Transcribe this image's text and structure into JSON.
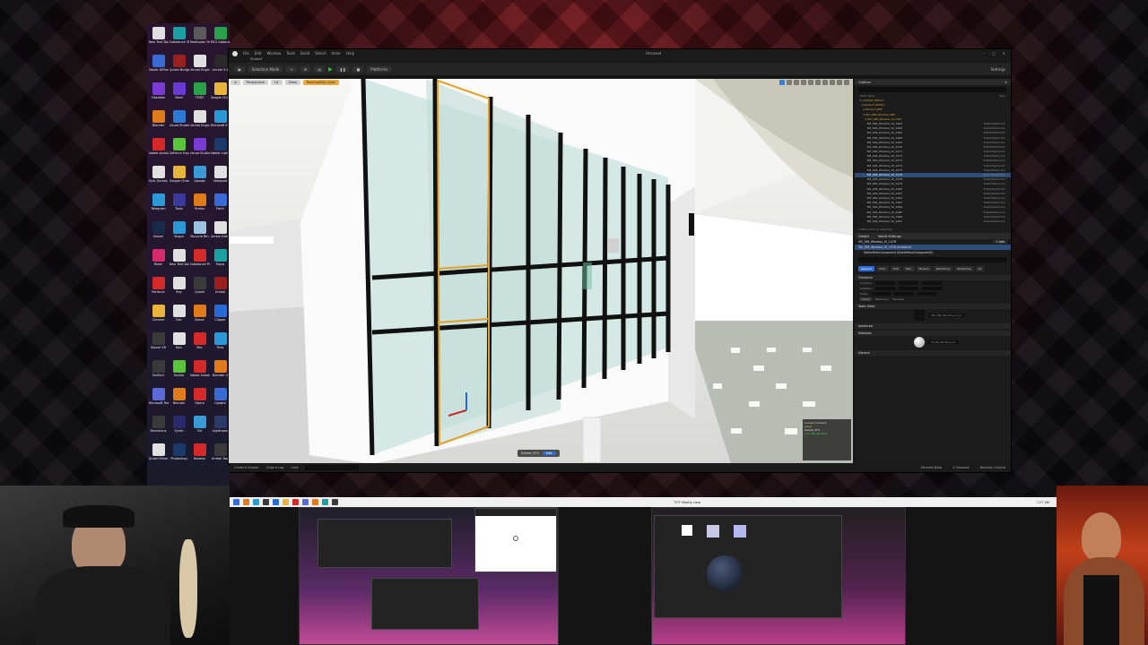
{
  "desktop": {
    "icons": [
      {
        "label": "New Text Document",
        "color": "#e0e0e0"
      },
      {
        "label": "Substance 3D Designer",
        "color": "#1aa1a1"
      },
      {
        "label": "Reallusion Hub",
        "color": "#5a5a5a"
      },
      {
        "label": "MCS Addons",
        "color": "#2aa04a"
      },
      {
        "label": "Stable Diffusion",
        "color": "#3a6ad6"
      },
      {
        "label": "Quixel Bridge",
        "color": "#9a1f1f"
      },
      {
        "label": "Unreal Engine",
        "color": "#e0e0e0"
      },
      {
        "label": "Unreal 5.4",
        "color": "#2a2a2a"
      },
      {
        "label": "Obsidian",
        "color": "#7a3ad6"
      },
      {
        "label": "Viber",
        "color": "#6a3ad6"
      },
      {
        "label": "TDR3",
        "color": "#2aa04a"
      },
      {
        "label": "Google Chrome",
        "color": "#e8b43a"
      },
      {
        "label": "Blender",
        "color": "#e07a1a"
      },
      {
        "label": "Visual Studio Code",
        "color": "#2a7ad6"
      },
      {
        "label": "Unreal Engine 5",
        "color": "#e0e0e0"
      },
      {
        "label": "Microsoft Edge",
        "color": "#2a9ad6"
      },
      {
        "label": "Adobe Acrobat",
        "color": "#d62a2a"
      },
      {
        "label": "GeForce Experience",
        "color": "#5ac43a"
      },
      {
        "label": "Visual Studio",
        "color": "#7a3ad6"
      },
      {
        "label": "Adobe Lightroom",
        "color": "#1a3a6a"
      },
      {
        "label": "Epic Games",
        "color": "#e0e0e0"
      },
      {
        "label": "Google Chrome",
        "color": "#e8b43a"
      },
      {
        "label": "Qooqle",
        "color": "#3a9ad6"
      },
      {
        "label": "Notepad",
        "color": "#e0e0e0"
      },
      {
        "label": "Telegram",
        "color": "#2a9ad6"
      },
      {
        "label": "Tools",
        "color": "#3a3a9a"
      },
      {
        "label": "Firefox",
        "color": "#e07a1a"
      },
      {
        "label": "Paint",
        "color": "#3a6ad6"
      },
      {
        "label": "Steam",
        "color": "#1a2a4a"
      },
      {
        "label": "Skype",
        "color": "#2a9ad6"
      },
      {
        "label": "Recycle Bin",
        "color": "#9ac4e0"
      },
      {
        "label": "Unreal Editor",
        "color": "#e0e0e0"
      },
      {
        "label": "Rider",
        "color": "#d62a6a"
      },
      {
        "label": "New Text Document",
        "color": "#e0e0e0"
      },
      {
        "label": "Substance Painter",
        "color": "#d62a2a"
      },
      {
        "label": "Maya",
        "color": "#1aa1a1"
      },
      {
        "label": "Perforce",
        "color": "#d62a2a"
      },
      {
        "label": "Ray",
        "color": "#e0e0e0"
      },
      {
        "label": "Quixel",
        "color": "#3a3a3a"
      },
      {
        "label": "Unreal",
        "color": "#9a1f1f"
      },
      {
        "label": "Chrome",
        "color": "#e8b43a"
      },
      {
        "label": "Doc",
        "color": "#e0e0e0"
      },
      {
        "label": "Brave",
        "color": "#e07a1a"
      },
      {
        "label": "Clipper",
        "color": "#2a6ad6"
      },
      {
        "label": "Steam VR",
        "color": "#3a3a3a"
      },
      {
        "label": "Epic",
        "color": "#e0e0e0"
      },
      {
        "label": "Rec",
        "color": "#d62a2a"
      },
      {
        "label": "Files",
        "color": "#2a9ad6"
      },
      {
        "label": "DaVinci",
        "color": "#3a3a3a"
      },
      {
        "label": "Nvidia",
        "color": "#5ac43a"
      },
      {
        "label": "Adobe Substance",
        "color": "#d62a2a"
      },
      {
        "label": "Blender 4",
        "color": "#e07a1a"
      },
      {
        "label": "Microsoft Teams",
        "color": "#5a6ad6"
      },
      {
        "label": "Blender",
        "color": "#e07a1a"
      },
      {
        "label": "Opera",
        "color": "#d62a2a"
      },
      {
        "label": "Update",
        "color": "#3a6ad6"
      },
      {
        "label": "Marvelous",
        "color": "#3a3a3a"
      },
      {
        "label": "Synth",
        "color": "#2a2a6a"
      },
      {
        "label": "Git",
        "color": "#3a9ad6"
      },
      {
        "label": "Lightroom",
        "color": "#2a3a6a"
      },
      {
        "label": "Quixel Mixer",
        "color": "#e0e0e0"
      },
      {
        "label": "Photoshop",
        "color": "#1a3a6a"
      },
      {
        "label": "Radeon",
        "color": "#d62a2a"
      },
      {
        "label": "Unreal Tool",
        "color": "#3a3a3a"
      },
      {
        "label": "Zoom",
        "color": "#2a6ad6"
      },
      {
        "label": "Sublime",
        "color": "#e07a1a"
      },
      {
        "label": "Discord",
        "color": "#5a6ad6"
      },
      {
        "label": "Affinity",
        "color": "#d62a2a"
      }
    ]
  },
  "ue": {
    "title": "Unsaved",
    "menu": [
      "File",
      "Edit",
      "Window",
      "Tools",
      "Build",
      "Select",
      "Actor",
      "Help"
    ],
    "level_name": "Studio3",
    "toolbar": {
      "mode": "Selection Mode",
      "platforms": "Platforms",
      "settings": "Settings"
    },
    "viewport": {
      "perspective": "Perspective",
      "lit": "Lit",
      "show": "Show",
      "highlight": "Reachability Lines",
      "status_label": "Delete_SFX",
      "status_btn": "Edit",
      "stats": [
        {
          "text": "Current Context",
          "cls": ""
        },
        {
          "text": "Level",
          "cls": "y"
        },
        {
          "text": "Delete_SFX",
          "cls": ""
        },
        {
          "text": "[ 1 ] SM_Window",
          "cls": "g"
        }
      ]
    },
    "outliner": {
      "tab": "Outliner",
      "col_label": "Item Label",
      "col_type": "Type",
      "rows": [
        {
          "name": "▾ Untitled (Editor)",
          "type": "",
          "folder": true,
          "sel": false
        },
        {
          "name": "  ▾ Studio3 (Editor)",
          "type": "",
          "folder": true,
          "sel": false
        },
        {
          "name": "    ▸ Studio3_B5F",
          "type": "",
          "folder": true,
          "sel": false
        },
        {
          "name": "    ▾ SM_18B_Window_GRP",
          "type": "",
          "folder": true,
          "sel": false
        },
        {
          "name": "      ▾ SM_186_Window_10_CRP",
          "type": "",
          "folder": true,
          "sel": false
        },
        {
          "name": "        SM_186_Window_10_1463",
          "type": "StaticMeshActor",
          "folder": false,
          "sel": false
        },
        {
          "name": "        SM_186_Window_10_1464",
          "type": "StaticMeshActor",
          "folder": false,
          "sel": false
        },
        {
          "name": "        SM_186_Window_10_1465",
          "type": "StaticMeshActor",
          "folder": false,
          "sel": false
        },
        {
          "name": "        SM_186_Window_10_1466",
          "type": "StaticMeshActor",
          "folder": false,
          "sel": false
        },
        {
          "name": "        SM_186_Window_10_1469",
          "type": "StaticMeshActor",
          "folder": false,
          "sel": false
        },
        {
          "name": "        SM_186_Window_10_1470",
          "type": "StaticMeshActor",
          "folder": false,
          "sel": false
        },
        {
          "name": "        SM_186_Window_10_1471",
          "type": "StaticMeshActor",
          "folder": false,
          "sel": false
        },
        {
          "name": "        SM_186_Window_10_1472",
          "type": "StaticMeshActor",
          "folder": false,
          "sel": false
        },
        {
          "name": "        SM_186_Window_10_1473",
          "type": "StaticMeshActor",
          "folder": false,
          "sel": false
        },
        {
          "name": "        SM_186_Window_10_1474",
          "type": "StaticMeshActor",
          "folder": false,
          "sel": false
        },
        {
          "name": "        SM_186_Window_10_1475",
          "type": "StaticMeshActor",
          "folder": false,
          "sel": false
        },
        {
          "name": "        SM_186_Window_10_1476",
          "type": "StaticMeshActor",
          "folder": false,
          "sel": true
        },
        {
          "name": "        SM_186_Window_10_1478",
          "type": "StaticMeshActor",
          "folder": false,
          "sel": false
        },
        {
          "name": "        SM_186_Window_10_1479",
          "type": "StaticMeshActor",
          "folder": false,
          "sel": false
        },
        {
          "name": "        SM_186_Window_10_1480",
          "type": "StaticMeshActor",
          "folder": false,
          "sel": false
        },
        {
          "name": "        SM_186_Window_10_1481",
          "type": "StaticMeshActor",
          "folder": false,
          "sel": false
        },
        {
          "name": "        SM_186_Window_10_1482",
          "type": "StaticMeshActor",
          "folder": false,
          "sel": false
        },
        {
          "name": "        SM_186_Window_10_1483",
          "type": "StaticMeshActor",
          "folder": false,
          "sel": false
        },
        {
          "name": "        SM_186_Window_10_1484",
          "type": "StaticMeshActor",
          "folder": false,
          "sel": false
        },
        {
          "name": "        SM_186_Window_10_1485",
          "type": "StaticMeshActor",
          "folder": false,
          "sel": false
        },
        {
          "name": "        SM_186_Window_10_1486",
          "type": "StaticMeshActor",
          "folder": false,
          "sel": false
        },
        {
          "name": "        SM_186_Window_10_1487",
          "type": "StaticMeshActor",
          "folder": false,
          "sel": false
        }
      ],
      "count": "1,065 actors (1 selected)"
    },
    "details": {
      "tabs": [
        "Details",
        "World Settings"
      ],
      "actor": "SM_186_Window_10_1476",
      "add": "+ Add",
      "components": [
        "SM_186_Window_10_1476 (Instance)",
        "StaticMeshComponent (StaticMeshComponent0)"
      ],
      "filter_tabs": [
        "General",
        "Actor",
        "LOD",
        "Misc",
        "Physics",
        "Rendering",
        "Streaming",
        "All"
      ],
      "sections": [
        "Transform",
        "Static Mesh",
        "Advanced",
        "Materials",
        "General"
      ],
      "transform_labels": [
        "Location",
        "Rotation",
        "Scale"
      ],
      "mobility": [
        "Static",
        "Stationary",
        "Movable"
      ],
      "static_mesh": "SM_186_Window_10_1",
      "material": "M_SM_Window_GL"
    },
    "bottom": {
      "items": [
        "Content Drawer",
        "Output Log",
        "Cmd"
      ],
      "right": [
        "Derived Data",
        "1 Unsaved",
        "Revision Control"
      ]
    }
  },
  "taskbar": {
    "clock": "7:27 AM",
    "weather": "73°F Mostly clear"
  }
}
